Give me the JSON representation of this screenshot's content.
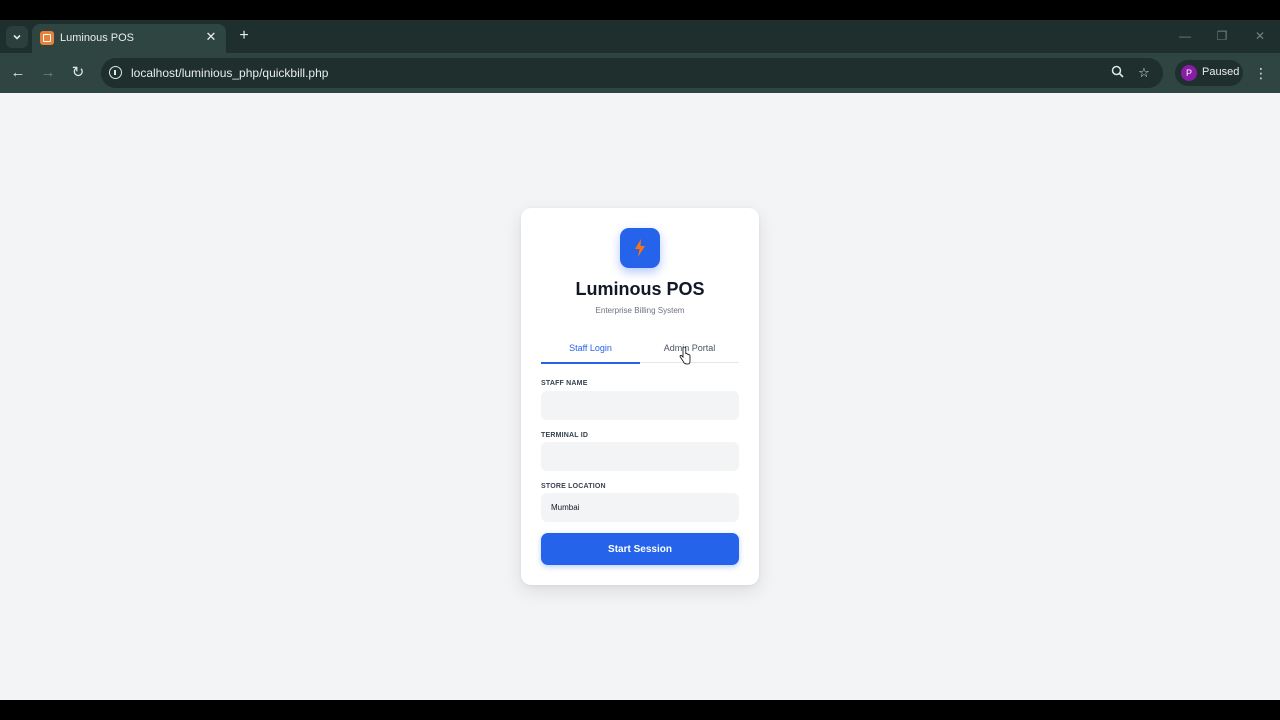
{
  "browser": {
    "tab_title": "Luminous POS",
    "url": "localhost/luminious_php/quickbill.php",
    "profile_initial": "P",
    "profile_status": "Paused"
  },
  "app": {
    "title": "Luminous POS",
    "subtitle": "Enterprise Billing System",
    "tabs": [
      {
        "label": "Staff Login",
        "active": true
      },
      {
        "label": "Admin Portal",
        "active": false
      }
    ],
    "fields": {
      "staff_name": {
        "label": "STAFF NAME",
        "value": ""
      },
      "terminal_id": {
        "label": "TERMINAL ID",
        "value": ""
      },
      "store_location": {
        "label": "STORE LOCATION",
        "value": "Mumbai"
      }
    },
    "submit_label": "Start Session"
  },
  "colors": {
    "accent": "#2563eb",
    "page_bg": "#f3f4f6",
    "browser_frame": "#2f4542",
    "bolt": "#f97316"
  },
  "icons": [
    "tab-search-icon",
    "favicon-icon",
    "close-icon",
    "plus-icon",
    "back-icon",
    "forward-icon",
    "reload-icon",
    "info-icon",
    "zoom-icon",
    "star-icon",
    "menu-icon",
    "bolt-icon",
    "cursor-icon"
  ]
}
